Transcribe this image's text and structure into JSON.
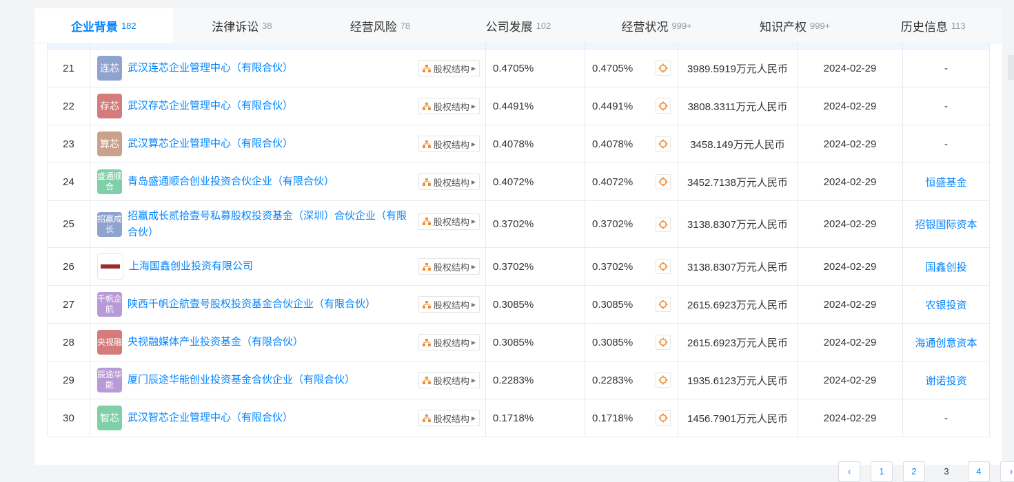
{
  "tabs": [
    {
      "label": "企业背景",
      "count": "182",
      "active": true
    },
    {
      "label": "法律诉讼",
      "count": "38"
    },
    {
      "label": "经营风险",
      "count": "78"
    },
    {
      "label": "公司发展",
      "count": "102"
    },
    {
      "label": "经营状况",
      "count": "999+"
    },
    {
      "label": "知识产权",
      "count": "999+"
    },
    {
      "label": "历史信息",
      "count": "113"
    }
  ],
  "equity_button_label": "股权结构",
  "rows": [
    {
      "idx": "21",
      "logo": "连芯",
      "logo_color": "#8fa3d1",
      "name": "武汉连芯企业管理中心（有限合伙）",
      "pct": "0.4705%",
      "pct2": "0.4705%",
      "amount": "3989.5919万元人民币",
      "date": "2024-02-29",
      "inst": "-"
    },
    {
      "idx": "22",
      "logo": "存芯",
      "logo_color": "#d47b7b",
      "name": "武汉存芯企业管理中心（有限合伙）",
      "pct": "0.4491%",
      "pct2": "0.4491%",
      "amount": "3808.3311万元人民币",
      "date": "2024-02-29",
      "inst": "-"
    },
    {
      "idx": "23",
      "logo": "算芯",
      "logo_color": "#caa28c",
      "name": "武汉算芯企业管理中心（有限合伙）",
      "pct": "0.4078%",
      "pct2": "0.4078%",
      "amount": "3458.149万元人民币",
      "date": "2024-02-29",
      "inst": "-"
    },
    {
      "idx": "24",
      "logo": "盛通顺合",
      "logo_color": "#7fcfa8",
      "name": "青岛盛通顺合创业投资合伙企业（有限合伙）",
      "pct": "0.4072%",
      "pct2": "0.4072%",
      "amount": "3452.7138万元人民币",
      "date": "2024-02-29",
      "inst": "恒盛基金"
    },
    {
      "idx": "25",
      "logo": "招赢成长",
      "logo_color": "#8fa3d1",
      "name": "招赢成长贰拾壹号私募股权投资基金（深圳）合伙企业（有限合伙）",
      "pct": "0.3702%",
      "pct2": "0.3702%",
      "amount": "3138.8307万元人民币",
      "date": "2024-02-29",
      "inst": "招银国际资本"
    },
    {
      "idx": "26",
      "logo": "",
      "logo_color": "#ffffff",
      "name": "上海国鑫创业投资有限公司",
      "pct": "0.3702%",
      "pct2": "0.3702%",
      "amount": "3138.8307万元人民币",
      "date": "2024-02-29",
      "inst": "国鑫创投"
    },
    {
      "idx": "27",
      "logo": "千帆企航",
      "logo_color": "#b99ad8",
      "name": "陕西千帆企航壹号股权投资基金合伙企业（有限合伙）",
      "pct": "0.3085%",
      "pct2": "0.3085%",
      "amount": "2615.6923万元人民币",
      "date": "2024-02-29",
      "inst": "农银投资"
    },
    {
      "idx": "28",
      "logo": "央视融",
      "logo_color": "#d47b7b",
      "name": "央视融媒体产业投资基金（有限合伙）",
      "pct": "0.3085%",
      "pct2": "0.3085%",
      "amount": "2615.6923万元人民币",
      "date": "2024-02-29",
      "inst": "海通创意资本"
    },
    {
      "idx": "29",
      "logo": "辰途华能",
      "logo_color": "#b99ad8",
      "name": "厦门辰途华能创业投资基金合伙企业（有限合伙）",
      "pct": "0.2283%",
      "pct2": "0.2283%",
      "amount": "1935.6123万元人民币",
      "date": "2024-02-29",
      "inst": "谢诺投资"
    },
    {
      "idx": "30",
      "logo": "智芯",
      "logo_color": "#7fcfa8",
      "name": "武汉智芯企业管理中心（有限合伙）",
      "pct": "0.1718%",
      "pct2": "0.1718%",
      "amount": "1456.7901万元人民币",
      "date": "2024-02-29",
      "inst": "-"
    }
  ],
  "pagination": {
    "prev": "‹",
    "pages": [
      "1",
      "2",
      "3",
      "4"
    ],
    "current": "3",
    "next": "›"
  },
  "colors": {
    "accent": "#0084ff",
    "orange": "#f08c2e"
  }
}
